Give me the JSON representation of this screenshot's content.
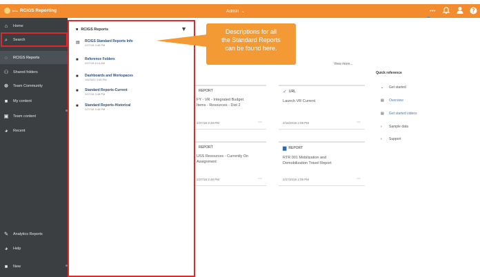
{
  "header": {
    "brand_small": "kms",
    "brand_name": "RCIGS Reporting",
    "admin_label": "Admin",
    "admin_chevron": "⌄",
    "icons": [
      "more-icon",
      "bell-icon",
      "user-icon",
      "help-icon"
    ]
  },
  "sidebar": {
    "items": [
      {
        "label": "Home",
        "icon": "⌂"
      },
      {
        "label": "Search",
        "icon": "⌕"
      },
      {
        "label": "RCIGS Reports",
        "icon": "◌"
      },
      {
        "label": "Shared folders",
        "icon": "⚇"
      },
      {
        "label": "Team Community",
        "icon": "☸"
      },
      {
        "label": "My content",
        "icon": "■"
      },
      {
        "label": "Team content",
        "icon": "▣"
      },
      {
        "label": "Recent",
        "icon": "◕"
      }
    ],
    "bottom_items": [
      {
        "label": "Analytics Reports",
        "icon": "✎"
      },
      {
        "label": "Help",
        "icon": "◕"
      },
      {
        "label": "New",
        "icon": "■"
      }
    ]
  },
  "panel": {
    "header": "RCIGS Reports",
    "filter_icon": "▼",
    "items": [
      {
        "name": "RCIGS Standard Reports Info",
        "date": "2/27/18 3:48 PM",
        "icon": "▤"
      },
      {
        "name": "Reference Folders",
        "date": "2/27/18 8:14 AM",
        "icon": "■"
      },
      {
        "name": "Dashboards and Workspaces",
        "date": "1/6/2020 3:08 PM",
        "icon": "■"
      },
      {
        "name": "Standard Reports-Current",
        "date": "2/27/18 3:48 PM",
        "icon": "■"
      },
      {
        "name": "Standard Reports-Historical",
        "date": "2/27/18 3:48 PM",
        "icon": "■"
      }
    ]
  },
  "callout": {
    "line1": "Descriptions for all",
    "line2": "the Standard Reports",
    "line3": "can be found here."
  },
  "main": {
    "view_more": "View more...",
    "cards": [
      {
        "type": "REPORT",
        "type_icon": "",
        "title_line1": "FY - VR - Integrated Budget",
        "title_line2": "Items - Resources - Dist 2",
        "date": "2/27/18 3:48 PM",
        "more": "⋯"
      },
      {
        "type": "URL",
        "type_icon": "✓",
        "title_line1": "Launch VR Current",
        "title_line2": "",
        "date": "2/16/2019 1:09 PM",
        "more": "⋯"
      },
      {
        "type": "REPORT",
        "type_icon": "",
        "title_line1": "USS Resources - Currently On",
        "title_line2": "Assignment",
        "date": "2/27/18 3:48 PM",
        "more": "⋯"
      },
      {
        "type": "REPORT",
        "type_icon": "▆",
        "title_line1": "RTR 001 Mobilization and",
        "title_line2": "Demobilization Travel Report",
        "date": "2/27/2019 1:09 PM",
        "more": "⋯"
      }
    ],
    "quick": {
      "title": "Quick reference",
      "items": [
        {
          "icon": "⌄",
          "label": "Get started"
        },
        {
          "icon": "▤",
          "label": "Overview"
        },
        {
          "icon": "▤",
          "label": "Get started videos"
        },
        {
          "icon": "›",
          "label": "Sample data"
        },
        {
          "icon": "›",
          "label": "Support"
        }
      ]
    }
  }
}
